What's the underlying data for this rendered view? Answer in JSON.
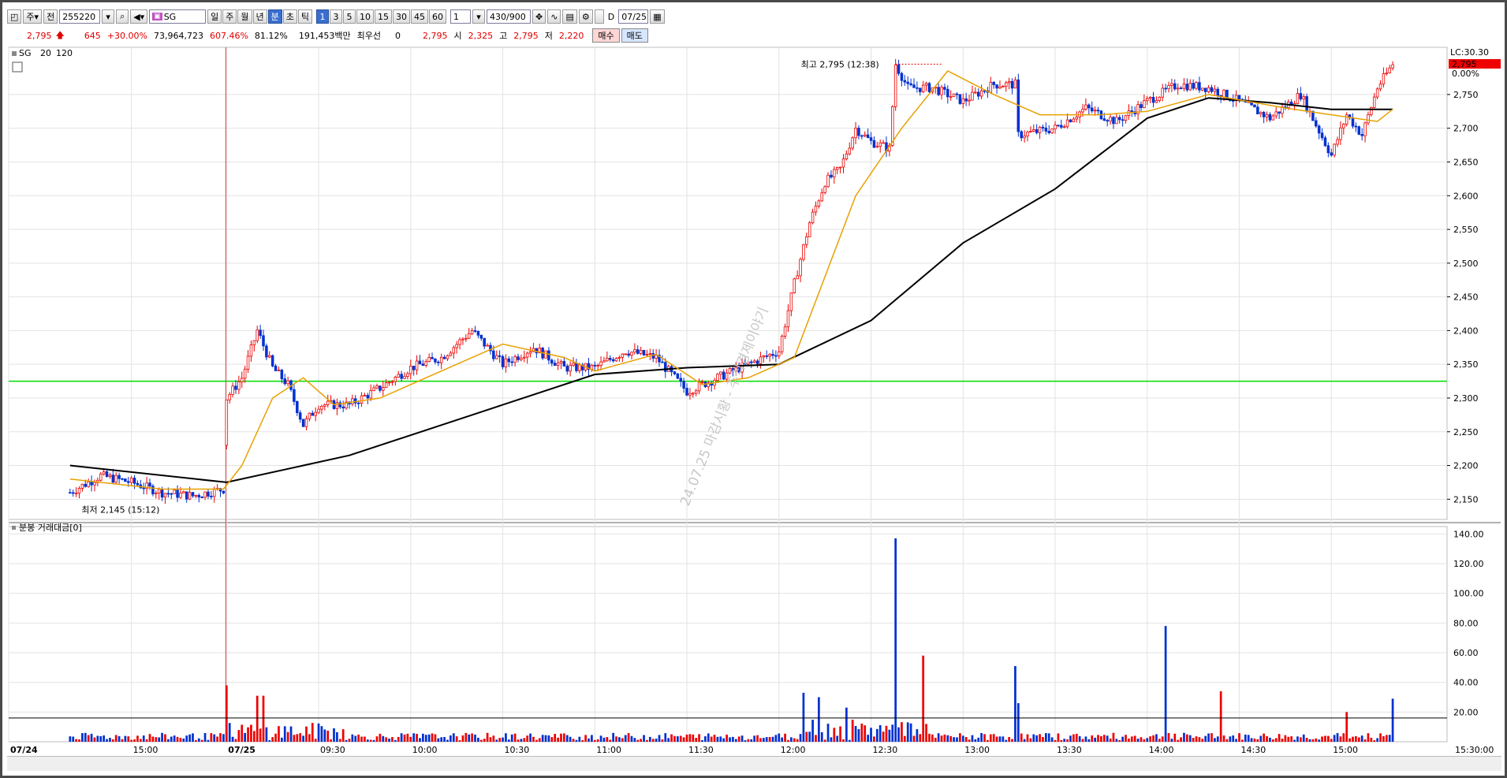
{
  "toolbar": {
    "type_label": "주",
    "all_label": "전",
    "code_value": "255220",
    "stock_name": "SG",
    "period_buttons": [
      "일",
      "주",
      "월",
      "년",
      "분",
      "초",
      "틱"
    ],
    "selected_period": "분",
    "interval_buttons": [
      "1",
      "3",
      "5",
      "10",
      "15",
      "30",
      "45",
      "60"
    ],
    "selected_interval": "1",
    "multiplier_value": "1",
    "count_value": "430/900",
    "d_label": "D",
    "date_value": "07/25"
  },
  "quote": {
    "price": "2,795",
    "change": "645",
    "change_pct": "+30.00%",
    "volume": "73,964,723",
    "volume_ratio": "607.46%",
    "ratio2": "81.12%",
    "amount": "191,453백만",
    "priority_label": "최우선",
    "priority_value": "0",
    "ask": "2,795",
    "open_label": "시",
    "open": "2,325",
    "high_label": "고",
    "high": "2,795",
    "low_label": "저",
    "low": "2,220",
    "buy_label": "매수",
    "sell_label": "매도"
  },
  "legend": {
    "name": "SG",
    "ma_short": "20",
    "ma_long": "120",
    "ma_short_color": "#e8a000",
    "ma_long_color": "#000000"
  },
  "annotations": {
    "high_note": "최고 2,795 (12:38)",
    "low_note": "최저 2,145 (15:12)",
    "watermark": "24.07.25 마감시황 - 주식경제이야기",
    "lc_label": "LC:30.30",
    "price_box": "2,795",
    "pct_box": "0.00%",
    "volume_title": "분봉 거래대금[0]",
    "time_end": "15:30:00"
  },
  "colors": {
    "up": "#ee0000",
    "down": "#0030d0",
    "support_line": "#00dd00",
    "grid": "#e2e2e2"
  },
  "chart_data": [
    {
      "type": "candlestick",
      "title": "SG",
      "ylim": [
        2120,
        2820
      ],
      "yticks": [
        "2,150",
        "2,200",
        "2,250",
        "2,300",
        "2,350",
        "2,400",
        "2,450",
        "2,500",
        "2,550",
        "2,600",
        "2,650",
        "2,700",
        "2,750"
      ],
      "xticks": [
        "07/24",
        "15:00",
        "07/25",
        "09:30",
        "10:00",
        "10:30",
        "11:00",
        "11:30",
        "12:00",
        "12:30",
        "13:00",
        "13:30",
        "14:00",
        "14:30",
        "15:00"
      ],
      "support_level": 2325,
      "close_path": [
        [
          "07/24 14:40",
          2160
        ],
        [
          "07/24 14:50",
          2185
        ],
        [
          "07/24 15:00",
          2175
        ],
        [
          "07/24 15:10",
          2160
        ],
        [
          "07/24 15:20",
          2155
        ],
        [
          "07/24 15:30",
          2165
        ],
        [
          "07/25 09:00",
          2300
        ],
        [
          "07/25 09:05",
          2330
        ],
        [
          "07/25 09:10",
          2400
        ],
        [
          "07/25 09:15",
          2345
        ],
        [
          "07/25 09:20",
          2320
        ],
        [
          "07/25 09:25",
          2260
        ],
        [
          "07/25 09:30",
          2290
        ],
        [
          "07/25 09:40",
          2290
        ],
        [
          "07/25 09:50",
          2315
        ],
        [
          "07/25 10:00",
          2345
        ],
        [
          "07/25 10:10",
          2360
        ],
        [
          "07/25 10:20",
          2400
        ],
        [
          "07/25 10:30",
          2350
        ],
        [
          "07/25 10:40",
          2375
        ],
        [
          "07/25 10:50",
          2345
        ],
        [
          "07/25 11:00",
          2345
        ],
        [
          "07/25 11:10",
          2370
        ],
        [
          "07/25 11:20",
          2360
        ],
        [
          "07/25 11:30",
          2310
        ],
        [
          "07/25 11:40",
          2330
        ],
        [
          "07/25 11:50",
          2350
        ],
        [
          "07/25 12:00",
          2370
        ],
        [
          "07/25 12:05",
          2470
        ],
        [
          "07/25 12:10",
          2560
        ],
        [
          "07/25 12:15",
          2620
        ],
        [
          "07/25 12:20",
          2640
        ],
        [
          "07/25 12:25",
          2700
        ],
        [
          "07/25 12:30",
          2680
        ],
        [
          "07/25 12:36",
          2670
        ],
        [
          "07/25 12:38",
          2795
        ],
        [
          "07/25 12:42",
          2760
        ],
        [
          "07/25 12:50",
          2760
        ],
        [
          "07/25 13:00",
          2740
        ],
        [
          "07/25 13:10",
          2765
        ],
        [
          "07/25 13:17",
          2765
        ],
        [
          "07/25 13:18",
          2690
        ],
        [
          "07/25 13:30",
          2700
        ],
        [
          "07/25 13:40",
          2730
        ],
        [
          "07/25 13:50",
          2710
        ],
        [
          "07/25 14:00",
          2740
        ],
        [
          "07/25 14:10",
          2765
        ],
        [
          "07/25 14:20",
          2760
        ],
        [
          "07/25 14:30",
          2740
        ],
        [
          "07/25 14:40",
          2715
        ],
        [
          "07/25 14:50",
          2750
        ],
        [
          "07/25 15:00",
          2660
        ],
        [
          "07/25 15:05",
          2720
        ],
        [
          "07/25 15:10",
          2690
        ],
        [
          "07/25 15:15",
          2760
        ],
        [
          "07/25 15:20",
          2795
        ]
      ],
      "ma20": [
        [
          "07/24 14:40",
          2180
        ],
        [
          "07/24 15:10",
          2165
        ],
        [
          "07/24 15:30",
          2165
        ],
        [
          "07/25 09:05",
          2200
        ],
        [
          "07/25 09:15",
          2300
        ],
        [
          "07/25 09:25",
          2330
        ],
        [
          "07/25 09:35",
          2290
        ],
        [
          "07/25 09:50",
          2300
        ],
        [
          "07/25 10:10",
          2340
        ],
        [
          "07/25 10:30",
          2380
        ],
        [
          "07/25 10:50",
          2360
        ],
        [
          "07/25 11:00",
          2340
        ],
        [
          "07/25 11:20",
          2365
        ],
        [
          "07/25 11:35",
          2320
        ],
        [
          "07/25 11:50",
          2330
        ],
        [
          "07/25 12:05",
          2360
        ],
        [
          "07/25 12:25",
          2600
        ],
        [
          "07/25 12:40",
          2700
        ],
        [
          "07/25 12:55",
          2785
        ],
        [
          "07/25 13:10",
          2750
        ],
        [
          "07/25 13:25",
          2720
        ],
        [
          "07/25 13:45",
          2720
        ],
        [
          "07/25 14:00",
          2725
        ],
        [
          "07/25 14:20",
          2750
        ],
        [
          "07/25 14:45",
          2730
        ],
        [
          "07/25 15:00",
          2720
        ],
        [
          "07/25 15:15",
          2710
        ],
        [
          "07/25 15:20",
          2728
        ]
      ],
      "ma120": [
        [
          "07/24 14:40",
          2200
        ],
        [
          "07/25 09:00",
          2175
        ],
        [
          "07/25 09:40",
          2215
        ],
        [
          "07/25 10:20",
          2275
        ],
        [
          "07/25 11:00",
          2335
        ],
        [
          "07/25 11:30",
          2345
        ],
        [
          "07/25 12:00",
          2350
        ],
        [
          "07/25 12:30",
          2415
        ],
        [
          "07/25 13:00",
          2530
        ],
        [
          "07/25 13:30",
          2610
        ],
        [
          "07/25 14:00",
          2715
        ],
        [
          "07/25 14:20",
          2745
        ],
        [
          "07/25 14:40",
          2738
        ],
        [
          "07/25 15:00",
          2728
        ],
        [
          "07/25 15:20",
          2728
        ]
      ]
    },
    {
      "type": "bar",
      "title": "분봉 거래대금[0]",
      "ylim": [
        0,
        145
      ],
      "yticks": [
        "20.00",
        "40.00",
        "60.00",
        "80.00",
        "100.00",
        "120.00",
        "140.00"
      ],
      "reference_level": 16,
      "spikes": [
        [
          "07/25 09:00",
          38
        ],
        [
          "07/25 09:10",
          31
        ],
        [
          "07/25 09:12",
          31
        ],
        [
          "07/25 12:08",
          33
        ],
        [
          "07/25 12:13",
          30
        ],
        [
          "07/25 12:22",
          23
        ],
        [
          "07/25 12:38",
          137
        ],
        [
          "07/25 12:47",
          58
        ],
        [
          "07/25 13:17",
          51
        ],
        [
          "07/25 13:18",
          26
        ],
        [
          "07/25 14:06",
          78
        ],
        [
          "07/25 14:24",
          34
        ],
        [
          "07/25 15:05",
          20
        ],
        [
          "07/25 15:20",
          29
        ]
      ]
    }
  ]
}
